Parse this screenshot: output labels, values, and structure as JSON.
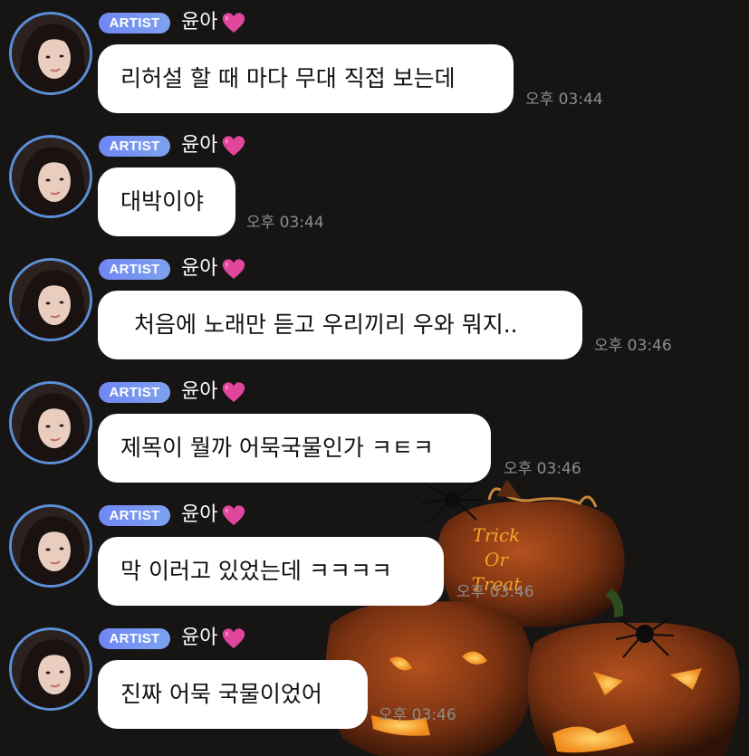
{
  "chat": {
    "messages": [
      {
        "badge": "ARTIST",
        "sender": "윤아",
        "text": "리허설 할 때 마다 무대 직접 보는데",
        "time": "오후 03:44"
      },
      {
        "badge": "ARTIST",
        "sender": "윤아",
        "text": "대박이야",
        "time": "오후 03:44"
      },
      {
        "badge": "ARTIST",
        "sender": "윤아",
        "text": "처음에 노래만 듣고 우리끼리 우와 뭐지..",
        "time": "오후 03:46"
      },
      {
        "badge": "ARTIST",
        "sender": "윤아",
        "text": "제목이 뭘까 어묵국물인가 ㅋㅌㅋ",
        "time": "오후 03:46"
      },
      {
        "badge": "ARTIST",
        "sender": "윤아",
        "text": "막 이러고 있었는데 ㅋㅋㅋㅋ",
        "time": "오후 03:46"
      },
      {
        "badge": "ARTIST",
        "sender": "윤아",
        "text": "진짜 어묵 국물이었어",
        "time": "오후 03:46"
      }
    ]
  },
  "background": {
    "pumpkin_carving_text": [
      "Trick",
      "Or",
      "Treat"
    ],
    "pumpkin_color": "#8c3a14",
    "glow_color": "#f5a623"
  },
  "colors": {
    "badge_gradient_start": "#6f86f5",
    "badge_gradient_end": "#7ea2ee",
    "avatar_ring": "#5b8fd8",
    "bubble": "#ffffff",
    "heart": "#e0469c",
    "time_text": "#8d8d8d"
  },
  "icons": {
    "heart": "pink-heart-icon"
  }
}
